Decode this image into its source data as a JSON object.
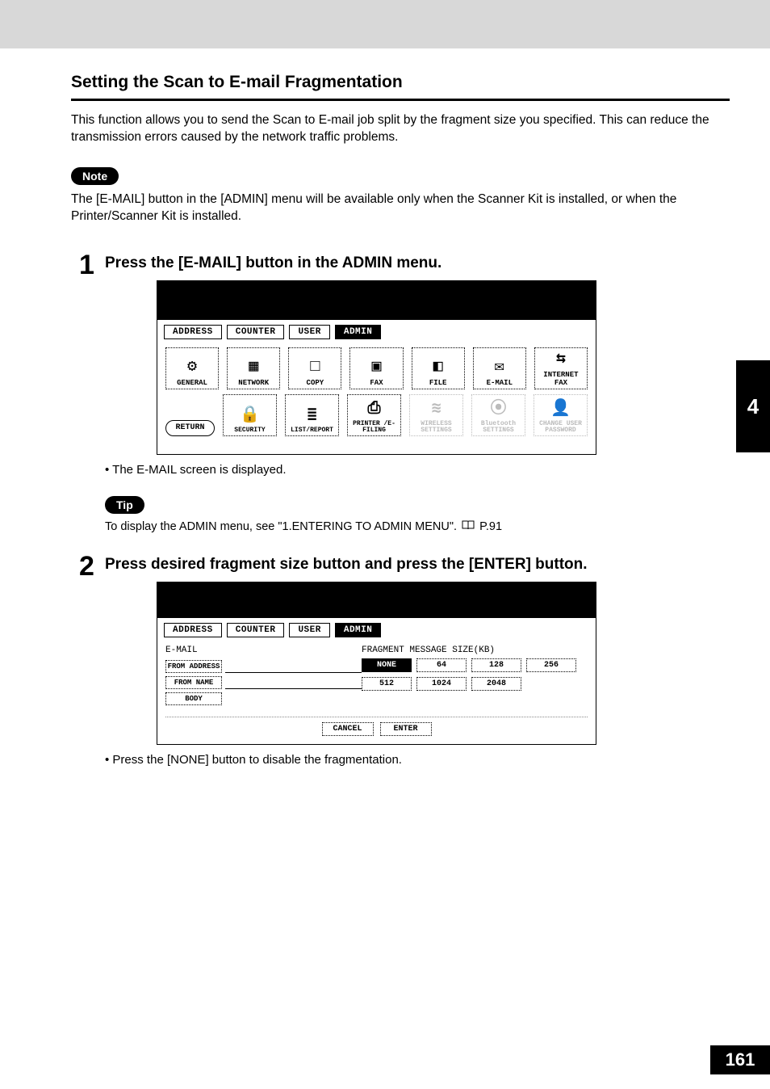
{
  "sideTab": "4",
  "pageNumber": "161",
  "heading": "Setting the Scan to E-mail Fragmentation",
  "intro": "This function allows you to send the Scan to E-mail job split by the fragment size you specified.  This can reduce the transmission errors caused by the network traffic problems.",
  "notePill": "Note",
  "noteText": "The [E-MAIL] button in the [ADMIN] menu will be available only when the Scanner Kit is installed, or when the Printer/Scanner Kit is installed.",
  "step1": {
    "num": "1",
    "title": "Press the [E-MAIL] button in the ADMIN menu.",
    "bullet": "The E-MAIL screen is displayed."
  },
  "tipPill": "Tip",
  "tipText": "To display the ADMIN menu, see \"1.ENTERING TO ADMIN MENU\".",
  "pageRef": "P.91",
  "step2": {
    "num": "2",
    "title": "Press desired fragment size button and press the [ENTER] button.",
    "bullet": "Press the [NONE] button to disable the fragmentation."
  },
  "ss1": {
    "tabs": [
      "ADDRESS",
      "COUNTER",
      "USER",
      "ADMIN"
    ],
    "selectedTab": "ADMIN",
    "row1": [
      "GENERAL",
      "NETWORK",
      "COPY",
      "FAX",
      "FILE",
      "E-MAIL",
      "INTERNET FAX"
    ],
    "row2": [
      "SECURITY",
      "LIST/REPORT",
      "PRINTER /E-FILING",
      "WIRELESS SETTINGS",
      "Bluetooth SETTINGS",
      "CHANGE USER PASSWORD"
    ],
    "returnLabel": "RETURN"
  },
  "ss2": {
    "tabs": [
      "ADDRESS",
      "COUNTER",
      "USER",
      "ADMIN"
    ],
    "selectedTab": "ADMIN",
    "leftTitle": "E-MAIL",
    "fields": [
      "FROM ADDRESS",
      "FROM NAME",
      "BODY"
    ],
    "rightTitle": "FRAGMENT MESSAGE SIZE(KB)",
    "sizes": [
      "NONE",
      "64",
      "128",
      "256",
      "512",
      "1024",
      "2048"
    ],
    "selectedSize": "NONE",
    "cancel": "CANCEL",
    "enter": "ENTER"
  }
}
